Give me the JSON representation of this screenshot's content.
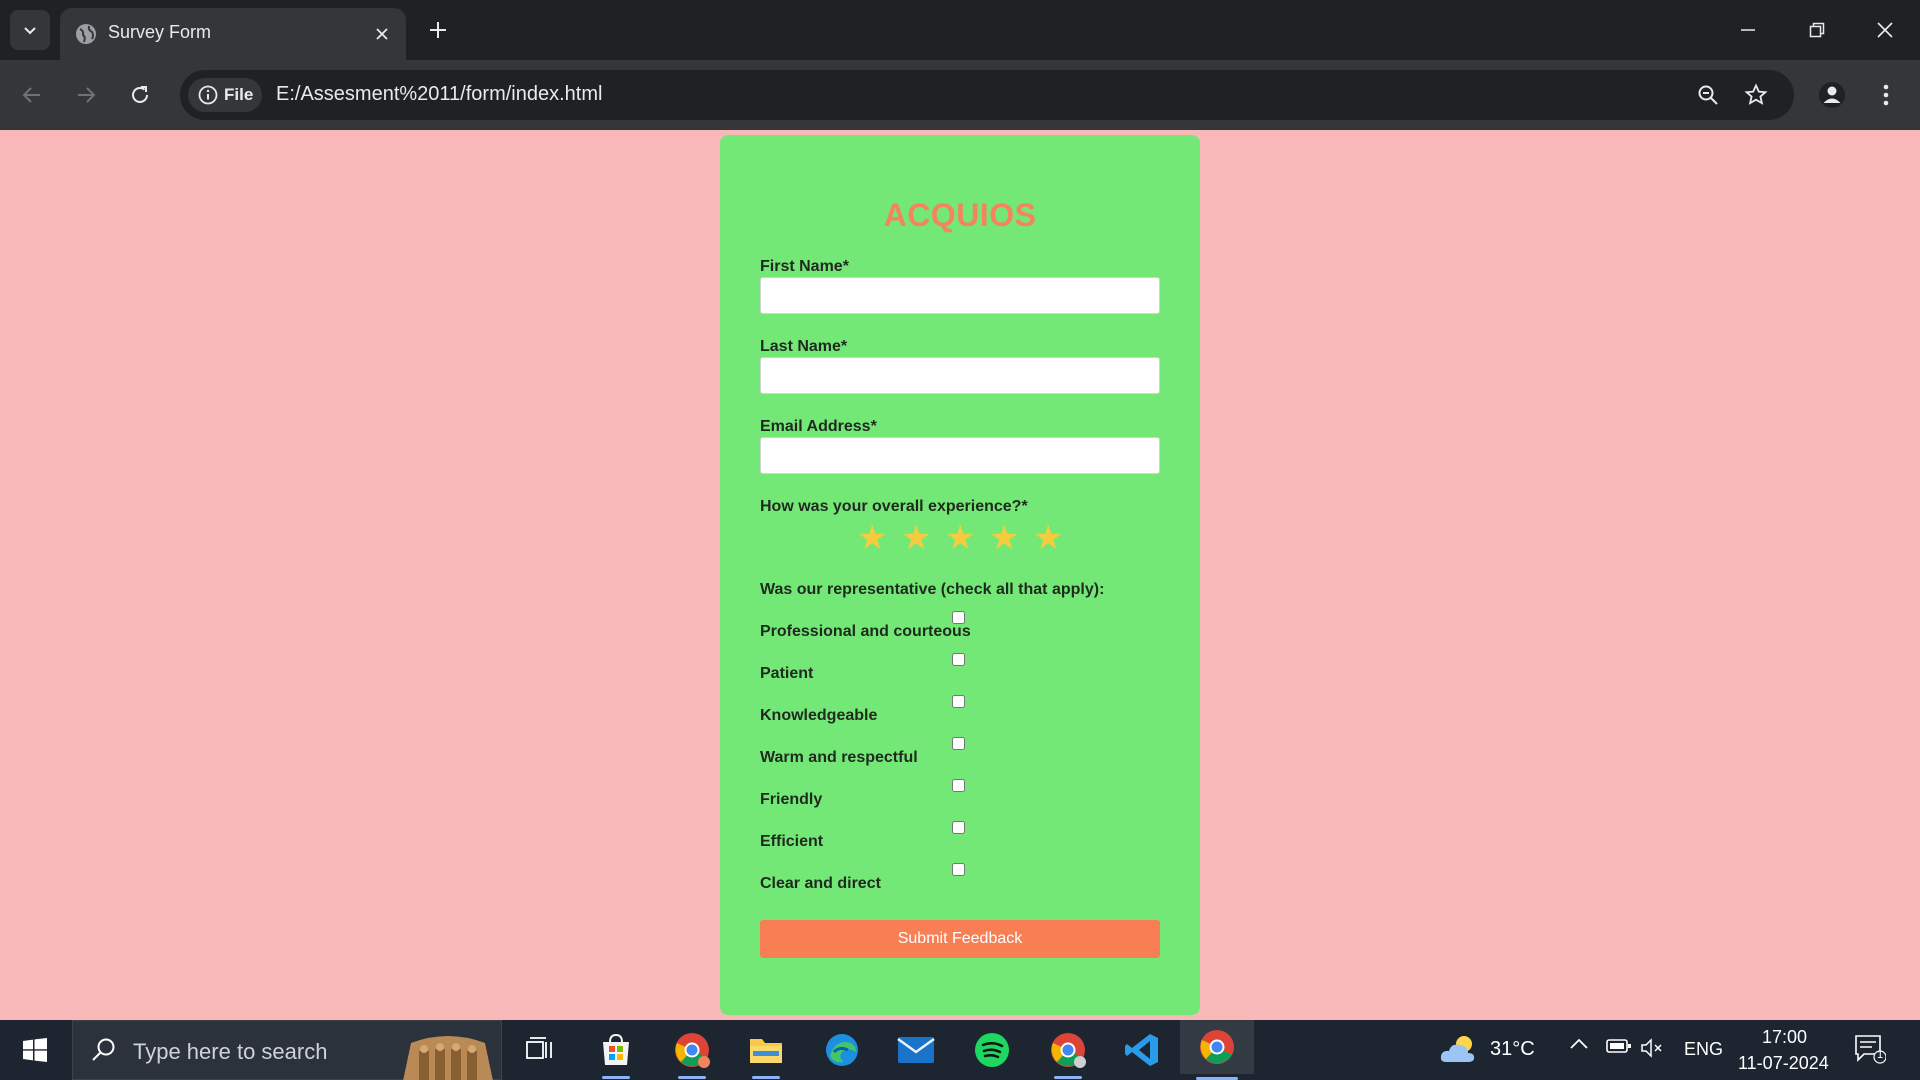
{
  "browser": {
    "tab_title": "Survey Form",
    "site_chip_label": "File",
    "url": "E:/Assesment%2011/form/index.html"
  },
  "form": {
    "brand": "ACQUIOS",
    "first_name_label": "First Name*",
    "last_name_label": "Last Name*",
    "email_label": "Email Address*",
    "first_name_value": "",
    "last_name_value": "",
    "email_value": "",
    "experience_label": "How was your overall experience?*",
    "rating_stars": 5,
    "representative_label": "Was our representative (check all that apply):",
    "options": [
      "Professional and courteous",
      "Patient",
      "Knowledgeable",
      "Warm and respectful",
      "Friendly",
      "Efficient",
      "Clear and direct"
    ],
    "submit_label": "Submit Feedback"
  },
  "taskbar": {
    "search_placeholder": "Type here to search",
    "weather": "31°C",
    "language": "ENG",
    "time": "17:00",
    "date": "11-07-2024",
    "notification_count": "1"
  },
  "colors": {
    "page_bg": "#f8b8b8",
    "card_bg": "#74e877",
    "brand": "#f4845f",
    "star": "#f5cc3d",
    "submit_bg": "#f87f54"
  }
}
